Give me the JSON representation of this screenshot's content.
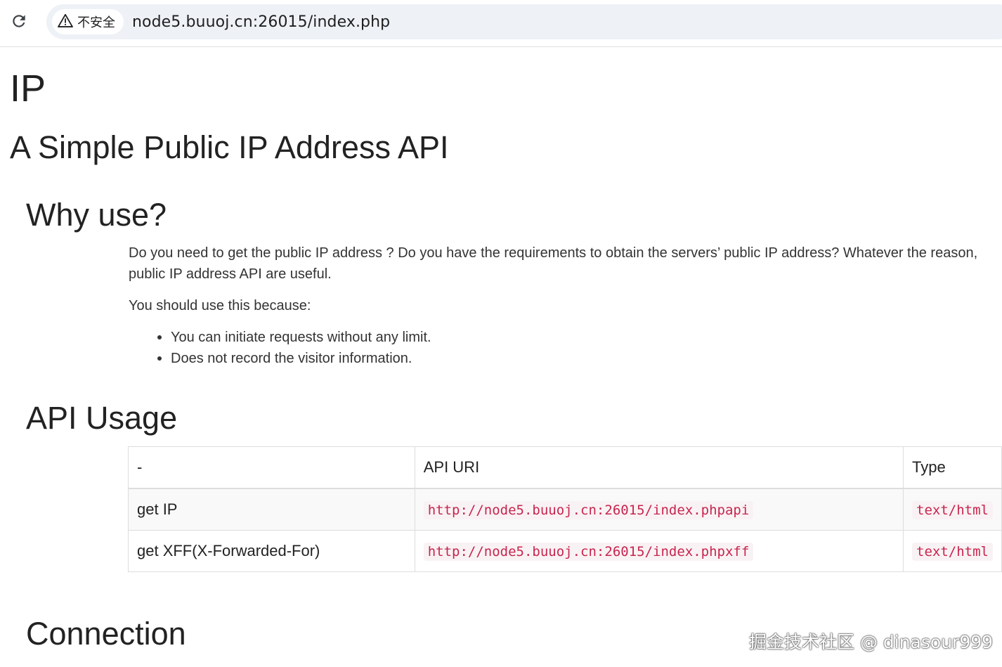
{
  "browser": {
    "security_label": "不安全",
    "url": "node5.buuoj.cn:26015/index.php"
  },
  "page": {
    "title": "IP",
    "subtitle": "A Simple Public IP Address API",
    "why": {
      "heading": "Why use?",
      "para_line1": "Do you need to get the public IP address ? Do you have the requirements to obtain the servers’ public IP address? Whatever the reason,",
      "para_line2": "public IP address API are useful.",
      "intro": "You should use this because:",
      "bullets": [
        "You can initiate requests without any limit.",
        "Does not record the visitor information."
      ]
    },
    "usage": {
      "heading": "API Usage",
      "headers": [
        "-",
        "API URI",
        "Type"
      ],
      "rows": [
        {
          "name": "get IP",
          "uri": "http://node5.buuoj.cn:26015/index.phpapi",
          "type": "text/html"
        },
        {
          "name": "get XFF(X-Forwarded-For)",
          "uri": "http://node5.buuoj.cn:26015/index.phpxff",
          "type": "text/html"
        }
      ]
    },
    "connection": {
      "heading": "Connection"
    }
  },
  "watermark": "掘金技术社区 @ dinasour999"
}
